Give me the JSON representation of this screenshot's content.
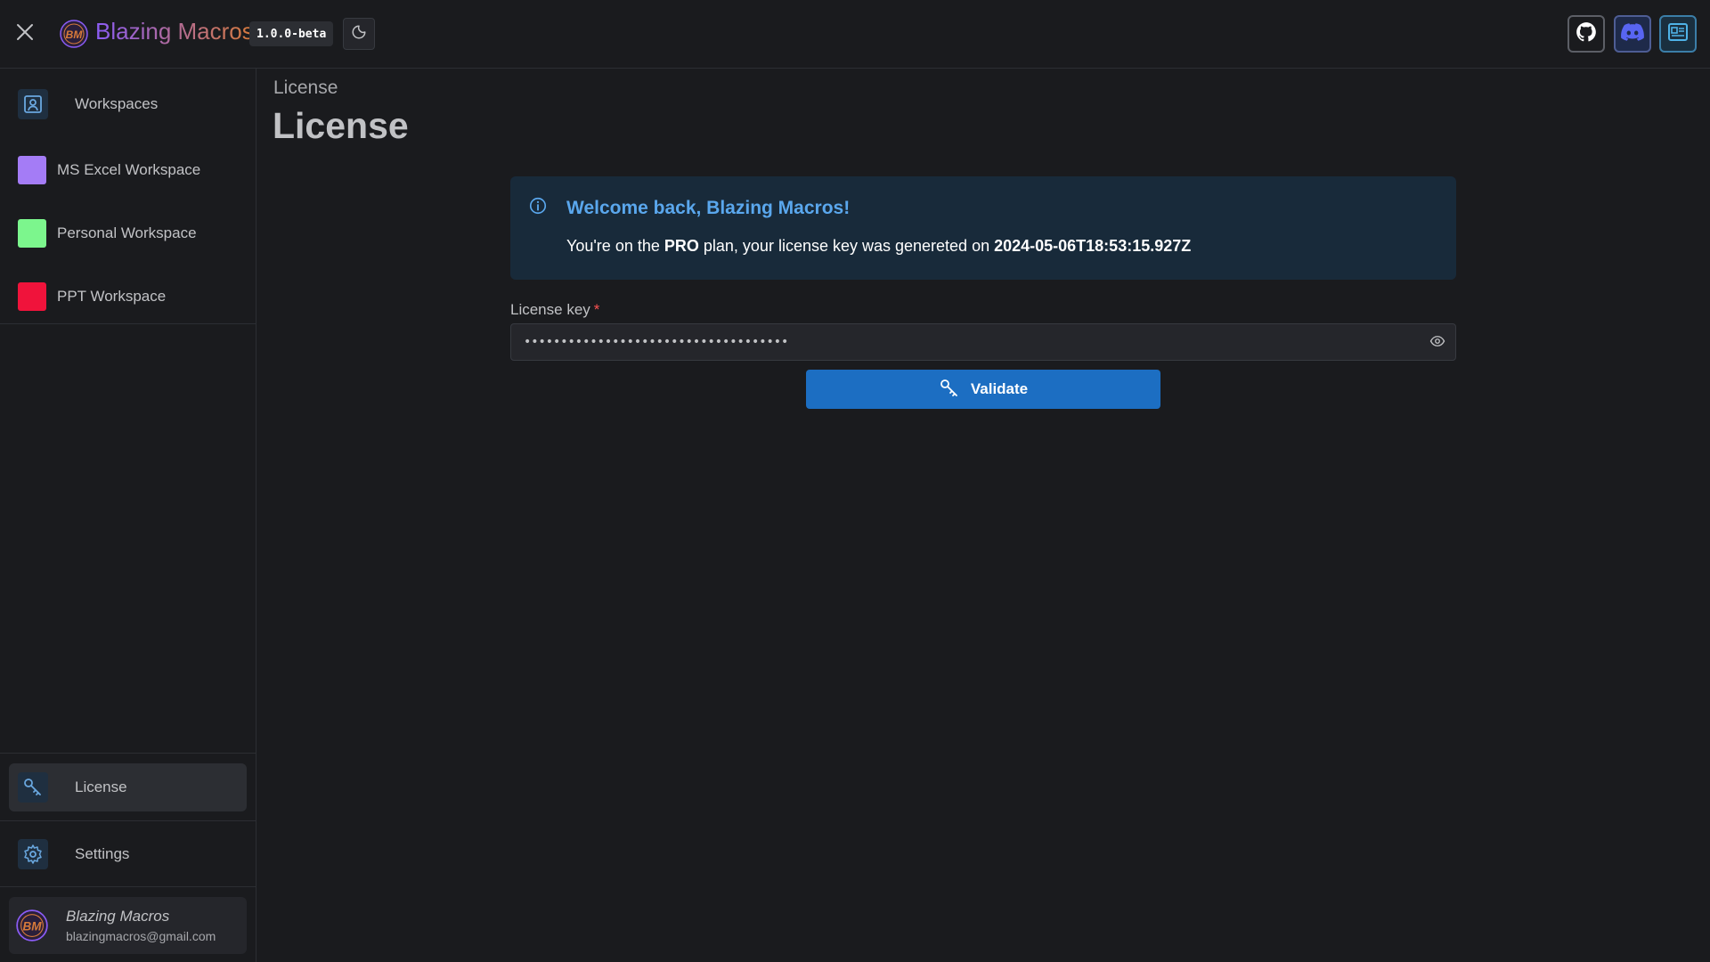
{
  "header": {
    "app_title": "Blazing Macros",
    "version": "1.0.0-beta",
    "logo_text": "BM"
  },
  "sidebar": {
    "workspaces_label": "Workspaces",
    "items": [
      {
        "label": "MS Excel Workspace",
        "color": "#a47cf6"
      },
      {
        "label": "Personal Workspace",
        "color": "#7cf68d"
      },
      {
        "label": "PPT Workspace",
        "color": "#f0133b"
      }
    ],
    "license_label": "License",
    "settings_label": "Settings",
    "user": {
      "name": "Blazing Macros",
      "email": "blazingmacros@gmail.com"
    }
  },
  "main": {
    "breadcrumb": "License",
    "title": "License",
    "alert": {
      "title": "Welcome back, Blazing Macros!",
      "prefix": "You're on the ",
      "plan": "PRO",
      "middle": " plan, your license key was genereted on ",
      "date": "2024-05-06T18:53:15.927Z"
    },
    "license_field": {
      "label": "License key",
      "required_mark": "*",
      "value": "••••••••••••••••••••••••••••••••••••"
    },
    "validate_label": "Validate"
  },
  "colors": {
    "accent": "#1c6ec2",
    "alert_bg": "#182a3a",
    "alert_title": "#5aa7ed"
  },
  "icons": {
    "close": "close-icon",
    "theme": "moon-icon",
    "github": "github-icon",
    "discord": "discord-icon",
    "news": "newspaper-icon",
    "workspaces": "user-square-icon",
    "license": "key-icon",
    "settings": "gear-icon",
    "info": "info-circle-icon",
    "eye": "eye-icon"
  }
}
